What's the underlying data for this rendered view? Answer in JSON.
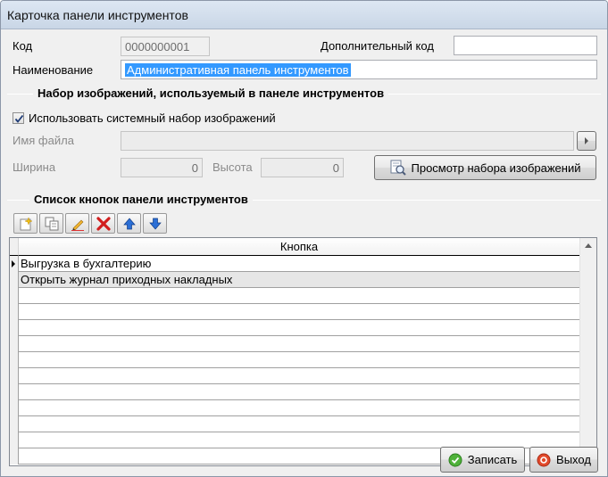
{
  "window": {
    "title": "Карточка панели инструментов"
  },
  "header": {
    "code_label": "Код",
    "code_value": "0000000001",
    "extra_code_label": "Дополнительный код",
    "extra_code_value": "",
    "name_label": "Наименование",
    "name_value": "Административная панель инструментов"
  },
  "images_group": {
    "title": "Набор изображений, используемый в панеле инструментов",
    "use_system_label": "Использовать системный набор изображений",
    "use_system_checked": true,
    "filename_label": "Имя файла",
    "filename_value": "",
    "width_label": "Ширина",
    "width_value": "0",
    "height_label": "Высота",
    "height_value": "0",
    "preview_button": "Просмотр набора изображений"
  },
  "buttons_group": {
    "title": "Список кнопок панели инструментов",
    "toolbar": [
      {
        "name": "add-icon"
      },
      {
        "name": "copy-icon"
      },
      {
        "name": "edit-icon"
      },
      {
        "name": "delete-icon"
      },
      {
        "name": "move-up-icon"
      },
      {
        "name": "move-down-icon"
      }
    ],
    "grid": {
      "column_header": "Кнопка",
      "rows": [
        "Выгрузка  в бухгалтерию",
        "Открыть журнал приходных накладных"
      ],
      "current_row_index": 0
    }
  },
  "footer": {
    "save_button": "Записать",
    "exit_button": "Выход"
  }
}
